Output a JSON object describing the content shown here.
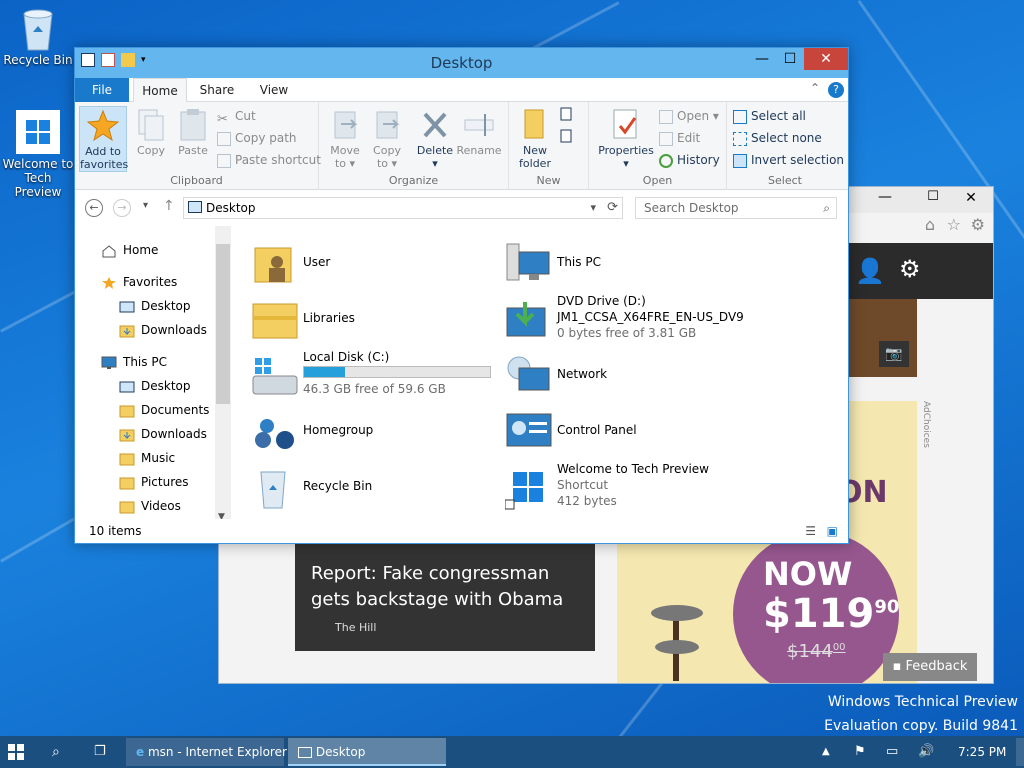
{
  "desktop": {
    "icons": [
      {
        "label": "Recycle Bin",
        "icon": "recycle-bin-icon"
      },
      {
        "label": "Welcome to Tech Preview",
        "icon": "windows-logo-icon"
      }
    ],
    "watermark_line1": "Windows Technical Preview",
    "watermark_line2": "Evaluation copy. Build 9841"
  },
  "background_window": {
    "title": "msn - Internet Explorer",
    "news_headline": "Report: Fake congressman gets backstage with Obama",
    "news_source": "The Hill",
    "ad_price": "$119",
    "ad_price_cents": "90",
    "ad_now": "NOW",
    "ad_old_price": "$144",
    "ad_old_cents": "00",
    "ad_partial": "ON",
    "adchoices": "AdChoices",
    "feedback": "Feedback"
  },
  "explorer": {
    "title": "Desktop",
    "tabs": {
      "file": "File",
      "home": "Home",
      "share": "Share",
      "view": "View"
    },
    "clipboard": {
      "add_to_favorites_1": "Add to",
      "add_to_favorites_2": "favorites",
      "copy": "Copy",
      "paste": "Paste",
      "cut": "Cut",
      "copy_path": "Copy path",
      "paste_shortcut": "Paste shortcut",
      "label": "Clipboard"
    },
    "organize": {
      "move_to_1": "Move",
      "move_to_2": "to ▾",
      "copy_to_1": "Copy",
      "copy_to_2": "to ▾",
      "delete_1": "Delete",
      "delete_2": "▾",
      "rename": "Rename",
      "label": "Organize"
    },
    "new": {
      "new_folder_1": "New",
      "new_folder_2": "folder",
      "label": "New"
    },
    "open": {
      "properties_1": "Properties",
      "properties_2": "▾",
      "open": "Open ▾",
      "edit": "Edit",
      "history": "History",
      "label": "Open"
    },
    "select": {
      "select_all": "Select all",
      "select_none": "Select none",
      "invert": "Invert selection",
      "label": "Select"
    },
    "address": {
      "path": "Desktop",
      "search_placeholder": "Search Desktop"
    },
    "nav": [
      {
        "label": "Home",
        "icon": "home-icon",
        "level": 0
      },
      {
        "label": "Favorites",
        "icon": "star-icon",
        "level": 0
      },
      {
        "label": "Desktop",
        "icon": "desktop-icon",
        "level": 1
      },
      {
        "label": "Downloads",
        "icon": "downloads-folder-icon",
        "level": 1
      },
      {
        "label": "This PC",
        "icon": "pc-icon",
        "level": 0
      },
      {
        "label": "Desktop",
        "icon": "desktop-icon",
        "level": 1
      },
      {
        "label": "Documents",
        "icon": "folder-icon",
        "level": 1
      },
      {
        "label": "Downloads",
        "icon": "downloads-folder-icon",
        "level": 1
      },
      {
        "label": "Music",
        "icon": "folder-icon",
        "level": 1
      },
      {
        "label": "Pictures",
        "icon": "folder-icon",
        "level": 1
      },
      {
        "label": "Videos",
        "icon": "folder-icon",
        "level": 1
      }
    ],
    "items": [
      {
        "name": "User",
        "icon": "user-folder-icon"
      },
      {
        "name": "This PC",
        "icon": "pc-icon"
      },
      {
        "name": "Libraries",
        "icon": "libraries-icon"
      },
      {
        "name": "DVD Drive (D:)",
        "line2": "JM1_CCSA_X64FRE_EN-US_DV9",
        "line3": "0 bytes free of 3.81 GB",
        "icon": "dvd-drive-icon"
      },
      {
        "name": "Local Disk (C:)",
        "line3": "46.3 GB free of 59.6 GB",
        "used_fraction": 0.22,
        "icon": "hard-disk-icon"
      },
      {
        "name": "Network",
        "icon": "network-icon"
      },
      {
        "name": "Homegroup",
        "icon": "homegroup-icon"
      },
      {
        "name": "Control Panel",
        "icon": "control-panel-icon"
      },
      {
        "name": "Recycle Bin",
        "icon": "recycle-bin-icon"
      },
      {
        "name": "Welcome to Tech Preview",
        "line2": "Shortcut",
        "line3": "412 bytes",
        "icon": "shortcut-icon"
      }
    ],
    "status": "10 items"
  },
  "taskbar": {
    "ie_label": "msn - Internet Explorer",
    "desktop_label": "Desktop",
    "time": "7:25 PM"
  }
}
